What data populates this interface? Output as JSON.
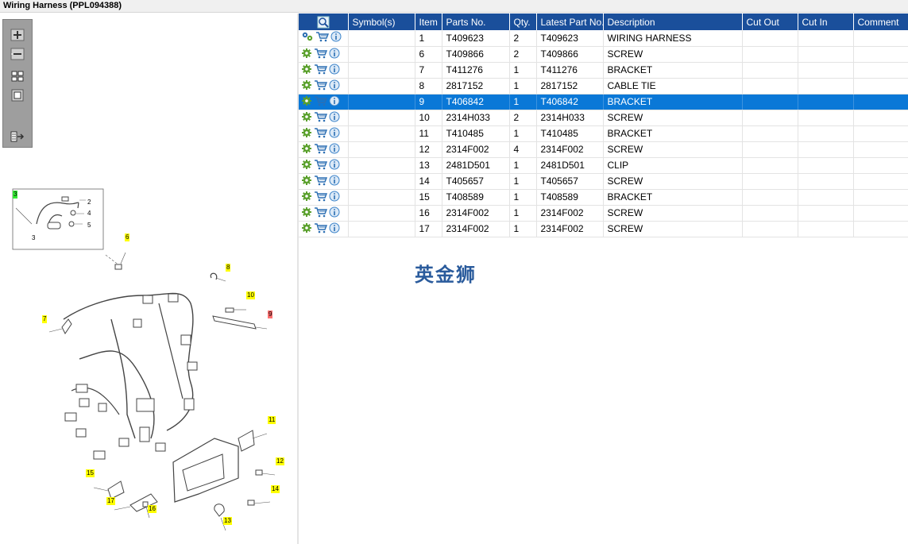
{
  "window": {
    "title": "Wiring Harness (PPL094388)"
  },
  "toolbar": {
    "buttons": [
      {
        "name": "zoom-in-icon"
      },
      {
        "name": "zoom-out-icon"
      },
      {
        "name": "fit-all-icon"
      },
      {
        "name": "fit-window-icon"
      },
      {
        "name": "export-icon"
      }
    ]
  },
  "diagram": {
    "callouts": [
      {
        "label": "3",
        "style": "green"
      },
      {
        "label": "2",
        "style": "plain"
      },
      {
        "label": "4",
        "style": "plain"
      },
      {
        "label": "5",
        "style": "plain"
      },
      {
        "label": "3",
        "style": "plain"
      },
      {
        "label": "6",
        "style": "yellow"
      },
      {
        "label": "8",
        "style": "yellow"
      },
      {
        "label": "10",
        "style": "yellow"
      },
      {
        "label": "7",
        "style": "yellow"
      },
      {
        "label": "9",
        "style": "red"
      },
      {
        "label": "11",
        "style": "yellow"
      },
      {
        "label": "12",
        "style": "yellow"
      },
      {
        "label": "15",
        "style": "yellow"
      },
      {
        "label": "17",
        "style": "yellow"
      },
      {
        "label": "16",
        "style": "yellow"
      },
      {
        "label": "14",
        "style": "yellow"
      },
      {
        "label": "13",
        "style": "yellow"
      }
    ]
  },
  "grid": {
    "header_icon": "search-parts-icon",
    "columns": [
      "",
      "Symbol(s)",
      "Item",
      "Parts No.",
      "Qty.",
      "Latest Part No.",
      "Description",
      "Cut Out",
      "Cut In",
      "Comment"
    ],
    "selected_row_index": 4,
    "rows": [
      {
        "item": "1",
        "part_no": "T409623",
        "qty": "2",
        "latest": "T409623",
        "desc": "WIRING HARNESS",
        "first_icon": "gears-icon"
      },
      {
        "item": "6",
        "part_no": "T409866",
        "qty": "2",
        "latest": "T409866",
        "desc": "SCREW",
        "first_icon": "gear-icon"
      },
      {
        "item": "7",
        "part_no": "T411276",
        "qty": "1",
        "latest": "T411276",
        "desc": "BRACKET",
        "first_icon": "gear-icon"
      },
      {
        "item": "8",
        "part_no": "2817152",
        "qty": "1",
        "latest": "2817152",
        "desc": "CABLE TIE",
        "first_icon": "gear-icon"
      },
      {
        "item": "9",
        "part_no": "T406842",
        "qty": "1",
        "latest": "T406842",
        "desc": "BRACKET",
        "first_icon": "gear-icon"
      },
      {
        "item": "10",
        "part_no": "2314H033",
        "qty": "2",
        "latest": "2314H033",
        "desc": "SCREW",
        "first_icon": "gear-icon"
      },
      {
        "item": "11",
        "part_no": "T410485",
        "qty": "1",
        "latest": "T410485",
        "desc": "BRACKET",
        "first_icon": "gear-icon"
      },
      {
        "item": "12",
        "part_no": "2314F002",
        "qty": "4",
        "latest": "2314F002",
        "desc": "SCREW",
        "first_icon": "gear-icon"
      },
      {
        "item": "13",
        "part_no": "2481D501",
        "qty": "1",
        "latest": "2481D501",
        "desc": "CLIP",
        "first_icon": "gear-icon"
      },
      {
        "item": "14",
        "part_no": "T405657",
        "qty": "1",
        "latest": "T405657",
        "desc": "SCREW",
        "first_icon": "gear-icon"
      },
      {
        "item": "15",
        "part_no": "T408589",
        "qty": "1",
        "latest": "T408589",
        "desc": "BRACKET",
        "first_icon": "gear-icon"
      },
      {
        "item": "16",
        "part_no": "2314F002",
        "qty": "1",
        "latest": "2314F002",
        "desc": "SCREW",
        "first_icon": "gear-icon"
      },
      {
        "item": "17",
        "part_no": "2314F002",
        "qty": "1",
        "latest": "2314F002",
        "desc": "SCREW",
        "first_icon": "gear-icon"
      }
    ]
  },
  "watermark": {
    "text": "英金狮"
  },
  "colors": {
    "header_bg": "#1a4f9b",
    "selected_row": "#0a78d7",
    "gear": "#5aa02c",
    "cart": "#2c6fb3",
    "info": "#3b83c9",
    "callout": "#ffff00"
  }
}
